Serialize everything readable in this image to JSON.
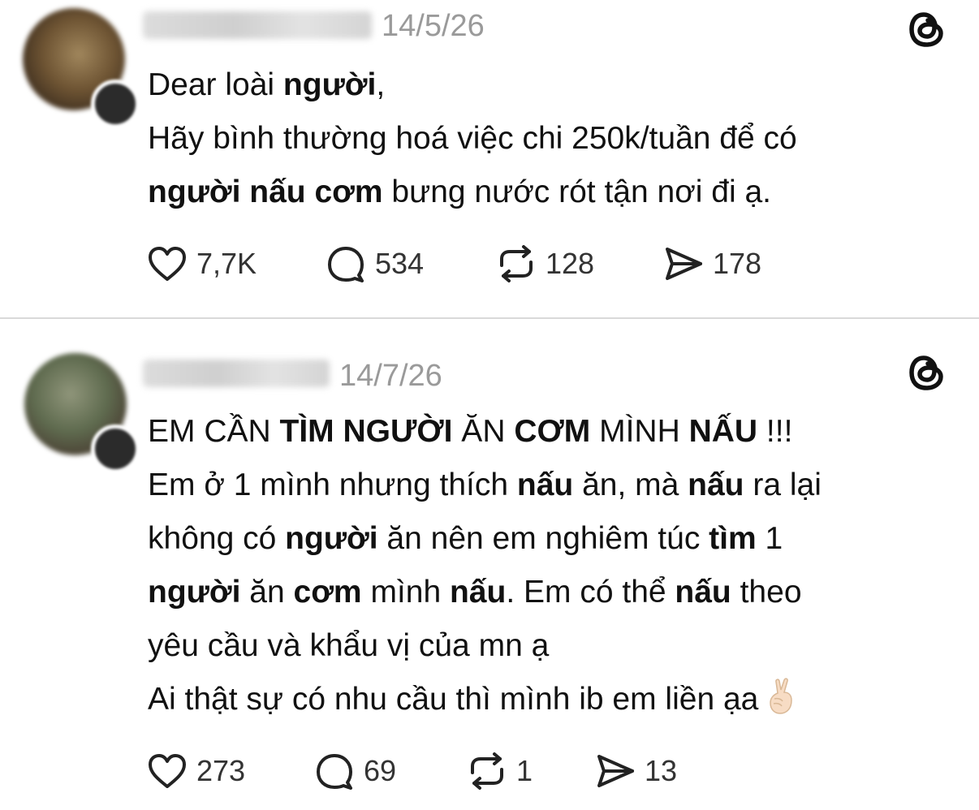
{
  "posts": [
    {
      "date": "14/5/26",
      "lines": [
        [
          {
            "t": "Dear loài ",
            "b": false
          },
          {
            "t": "người",
            "b": true
          },
          {
            "t": ",",
            "b": false
          }
        ],
        [
          {
            "t": "Hãy bình thường hoá việc chi 250k/tuần để có",
            "b": false
          }
        ],
        [
          {
            "t": "người nấu cơm",
            "b": true
          },
          {
            "t": " bưng nước rót tận nơi đi ạ.",
            "b": false
          }
        ]
      ],
      "likes": "7,7K",
      "comments": "534",
      "reposts": "128",
      "shares": "178"
    },
    {
      "date": "14/7/26",
      "lines": [
        [
          {
            "t": "EM CẦN ",
            "b": false
          },
          {
            "t": "TÌM NGƯỜI",
            "b": true
          },
          {
            "t": " ĂN ",
            "b": false
          },
          {
            "t": "CƠM",
            "b": true
          },
          {
            "t": " MÌNH ",
            "b": false
          },
          {
            "t": "NẤU",
            "b": true
          },
          {
            "t": " !!!",
            "b": false
          }
        ],
        [
          {
            "t": "Em ở 1 mình nhưng thích ",
            "b": false
          },
          {
            "t": "nấu",
            "b": true
          },
          {
            "t": " ăn, mà ",
            "b": false
          },
          {
            "t": "nấu",
            "b": true
          },
          {
            "t": " ra lại",
            "b": false
          }
        ],
        [
          {
            "t": "không có ",
            "b": false
          },
          {
            "t": "người",
            "b": true
          },
          {
            "t": " ăn nên em nghiêm túc ",
            "b": false
          },
          {
            "t": "tìm",
            "b": true
          },
          {
            "t": " 1",
            "b": false
          }
        ],
        [
          {
            "t": "người",
            "b": true
          },
          {
            "t": " ăn ",
            "b": false
          },
          {
            "t": "cơm",
            "b": true
          },
          {
            "t": " mình ",
            "b": false
          },
          {
            "t": "nấu",
            "b": true
          },
          {
            "t": ". Em có thể ",
            "b": false
          },
          {
            "t": "nấu",
            "b": true
          },
          {
            "t": " theo",
            "b": false
          }
        ],
        [
          {
            "t": "yêu cầu và khẩu vị của mn ạ",
            "b": false
          }
        ],
        [
          {
            "t": "Ai thật sự có nhu cầu thì mình ib em liền ạa",
            "b": false
          }
        ]
      ],
      "likes": "273",
      "comments": "69",
      "reposts": "1",
      "shares": "13"
    }
  ],
  "icons": {
    "like": "heart-icon",
    "comment": "comment-bubble-icon",
    "repost": "repost-icon",
    "share": "share-paper-plane-icon",
    "logo": "threads-logo-icon",
    "emoji": "crossed-fingers-emoji"
  },
  "colors": {
    "text": "#111111",
    "muted": "#9a9a9a",
    "divider": "#d9d9d9"
  }
}
